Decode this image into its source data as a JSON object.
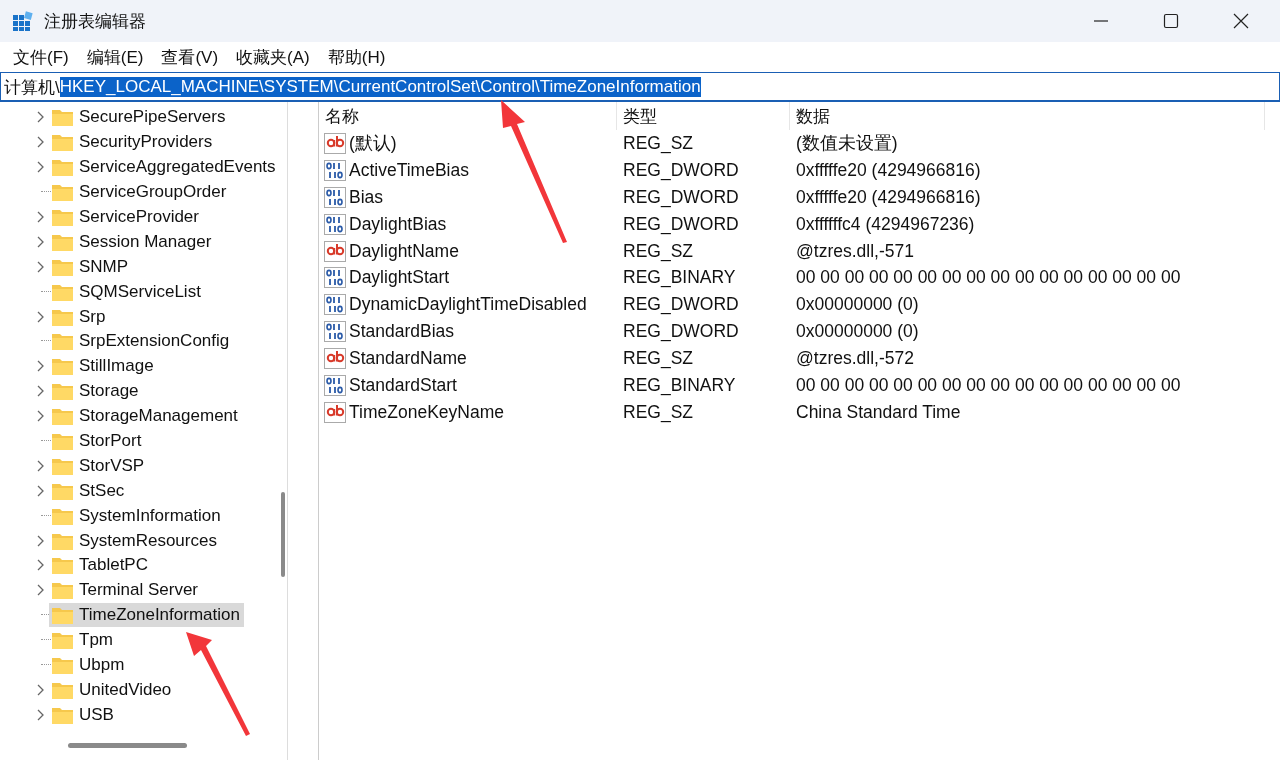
{
  "window": {
    "title": "注册表编辑器"
  },
  "menu": [
    "文件(F)",
    "编辑(E)",
    "查看(V)",
    "收藏夹(A)",
    "帮助(H)"
  ],
  "address": {
    "prefix": "计算机\\",
    "path": "HKEY_LOCAL_MACHINE\\SYSTEM\\CurrentControlSet\\Control\\TimeZoneInformation",
    "selected": true
  },
  "tree": [
    {
      "label": "SecurePipeServers",
      "expandable": true,
      "selected": false
    },
    {
      "label": "SecurityProviders",
      "expandable": true,
      "selected": false
    },
    {
      "label": "ServiceAggregatedEvents",
      "expandable": true,
      "selected": false
    },
    {
      "label": "ServiceGroupOrder",
      "expandable": false,
      "selected": false
    },
    {
      "label": "ServiceProvider",
      "expandable": true,
      "selected": false
    },
    {
      "label": "Session Manager",
      "expandable": true,
      "selected": false
    },
    {
      "label": "SNMP",
      "expandable": true,
      "selected": false
    },
    {
      "label": "SQMServiceList",
      "expandable": false,
      "selected": false
    },
    {
      "label": "Srp",
      "expandable": true,
      "selected": false
    },
    {
      "label": "SrpExtensionConfig",
      "expandable": false,
      "selected": false
    },
    {
      "label": "StillImage",
      "expandable": true,
      "selected": false
    },
    {
      "label": "Storage",
      "expandable": true,
      "selected": false
    },
    {
      "label": "StorageManagement",
      "expandable": true,
      "selected": false
    },
    {
      "label": "StorPort",
      "expandable": false,
      "selected": false
    },
    {
      "label": "StorVSP",
      "expandable": true,
      "selected": false
    },
    {
      "label": "StSec",
      "expandable": true,
      "selected": false
    },
    {
      "label": "SystemInformation",
      "expandable": false,
      "selected": false
    },
    {
      "label": "SystemResources",
      "expandable": true,
      "selected": false
    },
    {
      "label": "TabletPC",
      "expandable": true,
      "selected": false
    },
    {
      "label": "Terminal Server",
      "expandable": true,
      "selected": false
    },
    {
      "label": "TimeZoneInformation",
      "expandable": false,
      "selected": true
    },
    {
      "label": "Tpm",
      "expandable": false,
      "selected": false
    },
    {
      "label": "Ubpm",
      "expandable": false,
      "selected": false
    },
    {
      "label": "UnitedVideo",
      "expandable": true,
      "selected": false
    },
    {
      "label": "USB",
      "expandable": true,
      "selected": false
    }
  ],
  "table": {
    "columns": [
      "名称",
      "类型",
      "数据"
    ],
    "rows": [
      {
        "kind": "string",
        "name": "(默认)",
        "type": "REG_SZ",
        "data": "(数值未设置)"
      },
      {
        "kind": "binary",
        "name": "ActiveTimeBias",
        "type": "REG_DWORD",
        "data": "0xfffffe20 (4294966816)"
      },
      {
        "kind": "binary",
        "name": "Bias",
        "type": "REG_DWORD",
        "data": "0xfffffe20 (4294966816)"
      },
      {
        "kind": "binary",
        "name": "DaylightBias",
        "type": "REG_DWORD",
        "data": "0xffffffc4 (4294967236)"
      },
      {
        "kind": "string",
        "name": "DaylightName",
        "type": "REG_SZ",
        "data": "@tzres.dll,-571"
      },
      {
        "kind": "binary",
        "name": "DaylightStart",
        "type": "REG_BINARY",
        "data": "00 00 00 00 00 00 00 00 00 00 00 00 00 00 00 00"
      },
      {
        "kind": "binary",
        "name": "DynamicDaylightTimeDisabled",
        "type": "REG_DWORD",
        "data": "0x00000000 (0)"
      },
      {
        "kind": "binary",
        "name": "StandardBias",
        "type": "REG_DWORD",
        "data": "0x00000000 (0)"
      },
      {
        "kind": "string",
        "name": "StandardName",
        "type": "REG_SZ",
        "data": "@tzres.dll,-572"
      },
      {
        "kind": "binary",
        "name": "StandardStart",
        "type": "REG_BINARY",
        "data": "00 00 00 00 00 00 00 00 00 00 00 00 00 00 00 00"
      },
      {
        "kind": "string",
        "name": "TimeZoneKeyName",
        "type": "REG_SZ",
        "data": "China Standard Time"
      }
    ]
  }
}
